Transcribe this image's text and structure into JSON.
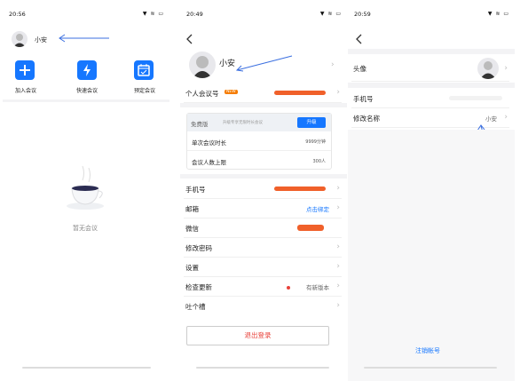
{
  "panel1": {
    "status_time": "20:56",
    "username": "小安",
    "actions": [
      {
        "label": "加入会议",
        "icon": "plus-icon"
      },
      {
        "label": "快速会议",
        "icon": "lightning-icon"
      },
      {
        "label": "预定会议",
        "icon": "calendar-icon"
      }
    ],
    "empty_text": "暂无会议"
  },
  "panel2": {
    "status_time": "20:49",
    "back_icon": "back-chevron-icon",
    "username": "小安",
    "meeting_id_label": "个人会议号",
    "new_badge": "NEW",
    "plan_tag": "免费版",
    "plan_hint": "升级专享无限时长会议",
    "upgrade_label": "升级",
    "single_duration_label": "单次会议时长",
    "single_duration_value": "9999分钟",
    "max_people_label": "会议人数上限",
    "max_people_value": "300人",
    "phone_label": "手机号",
    "email_label": "邮箱",
    "email_action": "点击绑定",
    "wechat_label": "微信",
    "change_password_label": "修改密码",
    "settings_label": "设置",
    "check_update_label": "检查更新",
    "new_version_text": "有新版本",
    "feedback_label": "吐个槽",
    "logout_label": "退出登录",
    "accent": "#1677ff",
    "danger": "#e8423a"
  },
  "panel3": {
    "status_time": "20:59",
    "avatar_label": "头像",
    "phone_label": "手机号",
    "rename_label": "修改名称",
    "rename_value": "小安",
    "delete_account_label": "注销帐号"
  }
}
